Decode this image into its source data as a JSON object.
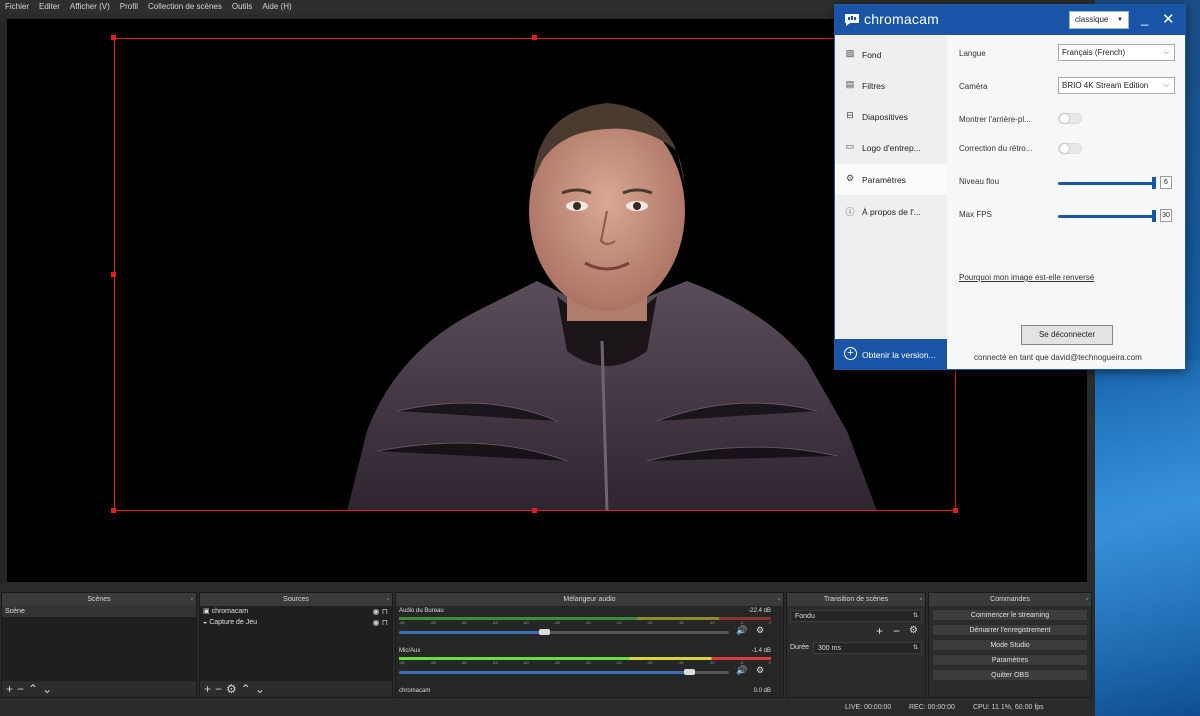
{
  "menu": [
    "Fichier",
    "Editer",
    "Afficher (V)",
    "Profil",
    "Collection de scènes",
    "Outils",
    "Aide (H)"
  ],
  "docks": {
    "scenes": {
      "title": "Scènes",
      "items": [
        "Scène"
      ]
    },
    "sources": {
      "title": "Sources",
      "items": [
        "chromacam",
        "Capture de Jeu"
      ]
    },
    "mixer": {
      "title": "Mélangeur audio",
      "ticks": [
        "-60",
        "-55",
        "-50",
        "-45",
        "-40",
        "-35",
        "-30",
        "-25",
        "-20",
        "-15",
        "-10",
        "-5",
        "0"
      ],
      "channels": [
        {
          "name": "Audio du Bureau",
          "db": "-22.4 dB",
          "volume": 0.44
        },
        {
          "name": "Mic/Aux",
          "db": "-1.4 dB",
          "volume": 0.88
        },
        {
          "name": "chromacam",
          "db": "0.0 dB"
        }
      ]
    },
    "transitions": {
      "title": "Transition de scènes",
      "selected": "Fondu",
      "duration_label": "Durée",
      "duration_value": "300 ms"
    },
    "commands": {
      "title": "Commandes",
      "buttons": [
        "Commencer le streaming",
        "Démarrer l'enregistrement",
        "Mode Studio",
        "Paramètres",
        "Quitter OBS"
      ]
    }
  },
  "status": {
    "live": "LIVE: 00:00:00",
    "rec": "REC: 00:00:00",
    "cpu": "CPU: 11.1%, 60.00 fps"
  },
  "chromacam": {
    "brand": "chromacam",
    "mode": "classique",
    "nav": [
      "Fond",
      "Filtres",
      "Diapositives",
      "Logo d'entrep...",
      "Paramètres",
      "À propos de l'..."
    ],
    "active_nav": "Paramètres",
    "upgrade": "Obtenir la version...",
    "settings": {
      "langue_label": "Langue",
      "langue_value": "Français (French)",
      "camera_label": "Caméra",
      "camera_value": "BRIO 4K Stream Edition",
      "show_bg_label": "Montrer l'arrière-pl...",
      "mirror_label": "Correction du rétro...",
      "blur_label": "Niveau flou",
      "blur_value": "6",
      "fps_label": "Max FPS",
      "fps_value": "30",
      "link": "Pourquoi mon image est-elle renversé"
    },
    "disconnect": "Se déconnecter",
    "connected": "connecté en tant que david@technogueira.com"
  },
  "colors": {
    "selection": "#e01e1e",
    "chromacam_blue": "#1a54a6",
    "obs_bg": "#2b2b2b"
  }
}
